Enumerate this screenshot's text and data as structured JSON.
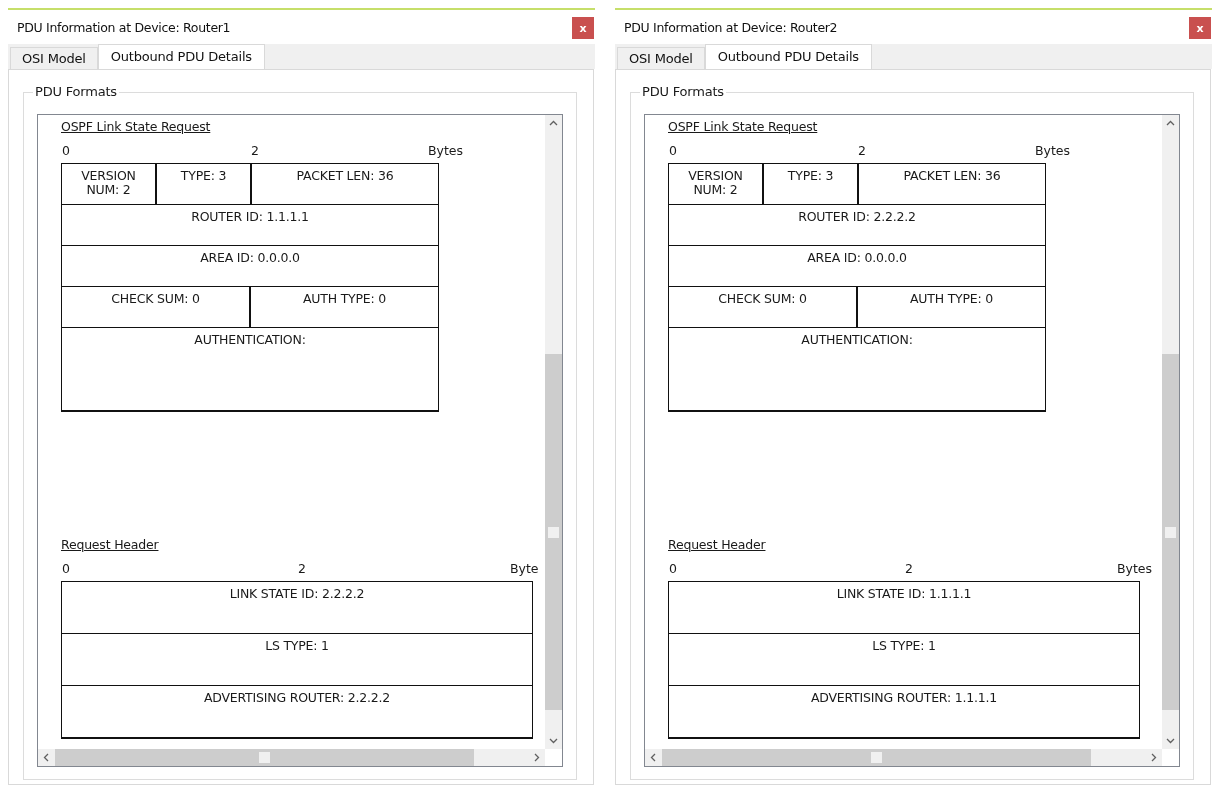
{
  "windows": [
    {
      "title": "PDU Information at Device: Router1",
      "close": "x",
      "tabs": [
        {
          "label": "OSI Model",
          "selected": false
        },
        {
          "label": "Outbound PDU Details",
          "selected": true
        }
      ],
      "group_label": "PDU Formats",
      "sections": [
        {
          "title": "OSPF Link State Request",
          "kind": "narrow",
          "ruler": [
            "0",
            "2",
            "Bytes"
          ],
          "words": [
            {
              "kind": "normal",
              "fields": [
                {
                  "text": "VERSION\nNUM: 2",
                  "kind": "quarter"
                },
                {
                  "text": "TYPE: 3",
                  "kind": "quarter"
                },
                {
                  "text": "PACKET LEN: 36",
                  "kind": "half"
                }
              ]
            },
            {
              "kind": "normal",
              "fields": [
                {
                  "text": "ROUTER ID: 1.1.1.1",
                  "kind": "full"
                }
              ]
            },
            {
              "kind": "normal",
              "fields": [
                {
                  "text": "AREA ID: 0.0.0.0",
                  "kind": "full"
                }
              ]
            },
            {
              "kind": "normal",
              "fields": [
                {
                  "text": "CHECK SUM: 0",
                  "kind": "half"
                },
                {
                  "text": "AUTH TYPE: 0",
                  "kind": "half"
                }
              ]
            },
            {
              "kind": "tall",
              "fields": [
                {
                  "text": "AUTHENTICATION:",
                  "kind": "full"
                }
              ]
            }
          ]
        },
        {
          "title": "Request Header",
          "kind": "wide",
          "ruler": [
            "0",
            "2",
            "Byte"
          ],
          "words": [
            {
              "kind": "medium",
              "fields": [
                {
                  "text": "LINK STATE ID: 2.2.2.2",
                  "kind": "full"
                }
              ]
            },
            {
              "kind": "medium",
              "fields": [
                {
                  "text": "LS TYPE: 1",
                  "kind": "full"
                }
              ]
            },
            {
              "kind": "medium",
              "fields": [
                {
                  "text": "ADVERTISING ROUTER: 2.2.2.2",
                  "kind": "full"
                }
              ]
            }
          ]
        }
      ]
    },
    {
      "title": "PDU Information at Device: Router2",
      "close": "x",
      "tabs": [
        {
          "label": "OSI Model",
          "selected": false
        },
        {
          "label": "Outbound PDU Details",
          "selected": true
        }
      ],
      "group_label": "PDU Formats",
      "sections": [
        {
          "title": "OSPF Link State Request",
          "kind": "narrow",
          "ruler": [
            "0",
            "2",
            "Bytes"
          ],
          "words": [
            {
              "kind": "normal",
              "fields": [
                {
                  "text": "VERSION\nNUM: 2",
                  "kind": "quarter"
                },
                {
                  "text": "TYPE: 3",
                  "kind": "quarter"
                },
                {
                  "text": "PACKET LEN: 36",
                  "kind": "half"
                }
              ]
            },
            {
              "kind": "normal",
              "fields": [
                {
                  "text": "ROUTER ID: 2.2.2.2",
                  "kind": "full"
                }
              ]
            },
            {
              "kind": "normal",
              "fields": [
                {
                  "text": "AREA ID: 0.0.0.0",
                  "kind": "full"
                }
              ]
            },
            {
              "kind": "normal",
              "fields": [
                {
                  "text": "CHECK SUM: 0",
                  "kind": "half"
                },
                {
                  "text": "AUTH TYPE: 0",
                  "kind": "half"
                }
              ]
            },
            {
              "kind": "tall",
              "fields": [
                {
                  "text": "AUTHENTICATION:",
                  "kind": "full"
                }
              ]
            }
          ]
        },
        {
          "title": "Request Header",
          "kind": "wide",
          "ruler": [
            "0",
            "2",
            "Bytes"
          ],
          "words": [
            {
              "kind": "medium",
              "fields": [
                {
                  "text": "LINK STATE ID: 1.1.1.1",
                  "kind": "full"
                }
              ]
            },
            {
              "kind": "medium",
              "fields": [
                {
                  "text": "LS TYPE: 1",
                  "kind": "full"
                }
              ]
            },
            {
              "kind": "medium",
              "fields": [
                {
                  "text": "ADVERTISING ROUTER: 1.1.1.1",
                  "kind": "full"
                }
              ]
            }
          ]
        }
      ]
    }
  ]
}
